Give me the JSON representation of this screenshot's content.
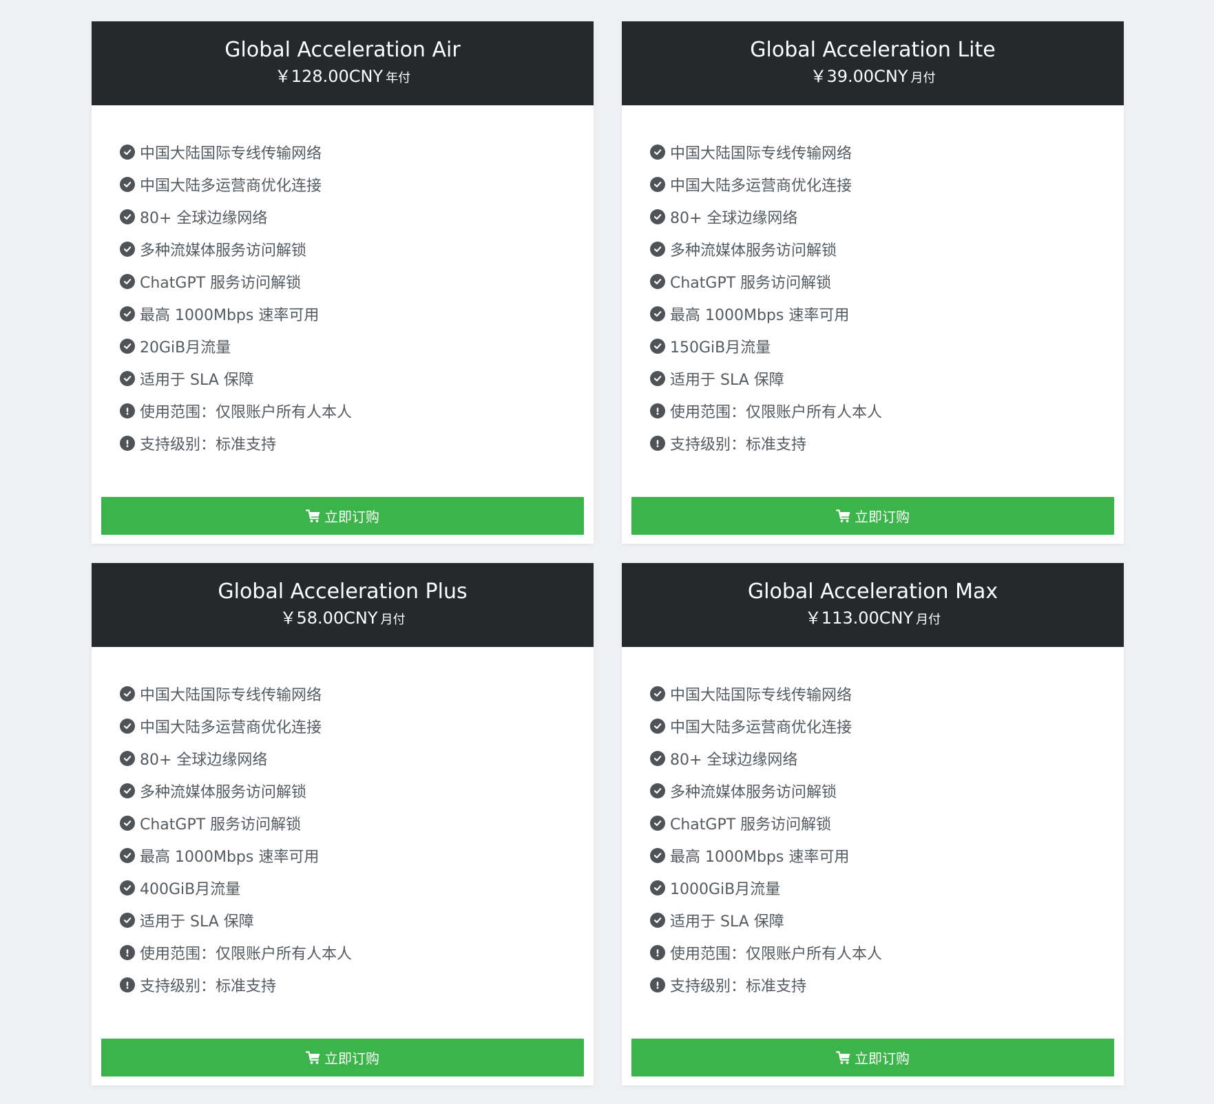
{
  "plans": [
    {
      "name": "Global Acceleration Air",
      "price": "￥128.00CNY",
      "cycle": "年付",
      "features": [
        {
          "icon": "check-circle-icon",
          "text": "中国大陆国际专线传输网络"
        },
        {
          "icon": "check-circle-icon",
          "text": "中国大陆多运营商优化连接"
        },
        {
          "icon": "check-circle-icon",
          "text": "80+ 全球边缘网络"
        },
        {
          "icon": "check-circle-icon",
          "text": "多种流媒体服务访问解锁"
        },
        {
          "icon": "check-circle-icon",
          "text": "ChatGPT 服务访问解锁"
        },
        {
          "icon": "check-circle-icon",
          "text": "最高 1000Mbps 速率可用"
        },
        {
          "icon": "check-circle-icon",
          "text": "20GiB月流量"
        },
        {
          "icon": "check-circle-icon",
          "text": "适用于 SLA 保障"
        },
        {
          "icon": "exclamation-circle-icon",
          "text": "使用范围：仅限账户所有人本人"
        },
        {
          "icon": "exclamation-circle-icon",
          "text": "支持级别：标准支持"
        }
      ],
      "button_label": "立即订购"
    },
    {
      "name": "Global Acceleration Lite",
      "price": "￥39.00CNY",
      "cycle": "月付",
      "features": [
        {
          "icon": "check-circle-icon",
          "text": "中国大陆国际专线传输网络"
        },
        {
          "icon": "check-circle-icon",
          "text": "中国大陆多运营商优化连接"
        },
        {
          "icon": "check-circle-icon",
          "text": "80+ 全球边缘网络"
        },
        {
          "icon": "check-circle-icon",
          "text": "多种流媒体服务访问解锁"
        },
        {
          "icon": "check-circle-icon",
          "text": "ChatGPT 服务访问解锁"
        },
        {
          "icon": "check-circle-icon",
          "text": "最高 1000Mbps 速率可用"
        },
        {
          "icon": "check-circle-icon",
          "text": "150GiB月流量"
        },
        {
          "icon": "check-circle-icon",
          "text": "适用于 SLA 保障"
        },
        {
          "icon": "exclamation-circle-icon",
          "text": "使用范围：仅限账户所有人本人"
        },
        {
          "icon": "exclamation-circle-icon",
          "text": "支持级别：标准支持"
        }
      ],
      "button_label": "立即订购"
    },
    {
      "name": "Global Acceleration Plus",
      "price": "￥58.00CNY",
      "cycle": "月付",
      "features": [
        {
          "icon": "check-circle-icon",
          "text": "中国大陆国际专线传输网络"
        },
        {
          "icon": "check-circle-icon",
          "text": "中国大陆多运营商优化连接"
        },
        {
          "icon": "check-circle-icon",
          "text": "80+ 全球边缘网络"
        },
        {
          "icon": "check-circle-icon",
          "text": "多种流媒体服务访问解锁"
        },
        {
          "icon": "check-circle-icon",
          "text": "ChatGPT 服务访问解锁"
        },
        {
          "icon": "check-circle-icon",
          "text": "最高 1000Mbps 速率可用"
        },
        {
          "icon": "check-circle-icon",
          "text": "400GiB月流量"
        },
        {
          "icon": "check-circle-icon",
          "text": "适用于 SLA 保障"
        },
        {
          "icon": "exclamation-circle-icon",
          "text": "使用范围：仅限账户所有人本人"
        },
        {
          "icon": "exclamation-circle-icon",
          "text": "支持级别：标准支持"
        }
      ],
      "button_label": "立即订购"
    },
    {
      "name": "Global Acceleration Max",
      "price": "￥113.00CNY",
      "cycle": "月付",
      "features": [
        {
          "icon": "check-circle-icon",
          "text": "中国大陆国际专线传输网络"
        },
        {
          "icon": "check-circle-icon",
          "text": "中国大陆多运营商优化连接"
        },
        {
          "icon": "check-circle-icon",
          "text": "80+ 全球边缘网络"
        },
        {
          "icon": "check-circle-icon",
          "text": "多种流媒体服务访问解锁"
        },
        {
          "icon": "check-circle-icon",
          "text": "ChatGPT 服务访问解锁"
        },
        {
          "icon": "check-circle-icon",
          "text": "最高 1000Mbps 速率可用"
        },
        {
          "icon": "check-circle-icon",
          "text": "1000GiB月流量"
        },
        {
          "icon": "check-circle-icon",
          "text": "适用于 SLA 保障"
        },
        {
          "icon": "exclamation-circle-icon",
          "text": "使用范围：仅限账户所有人本人"
        },
        {
          "icon": "exclamation-circle-icon",
          "text": "支持级别：标准支持"
        }
      ],
      "button_label": "立即订购"
    }
  ],
  "colors": {
    "page_background": "#eef1f4",
    "header_background": "#26292c",
    "button_green": "#3bb54a",
    "feature_text": "#555a5f",
    "icon_fill": "#4f5357"
  }
}
